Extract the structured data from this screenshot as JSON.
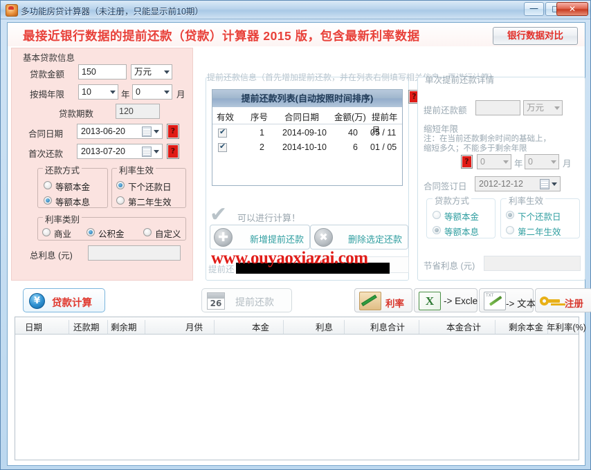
{
  "window": {
    "title": "多功能房贷计算器（未注册，只能显示前10期）",
    "minimize": "—",
    "maximize": "□",
    "close": "✕"
  },
  "banner": {
    "headline": "最接近银行数据的提前还款（贷款）计算器 2015 版，包含最新利率数据",
    "bank_compare_button": "银行数据对比"
  },
  "left_panel": {
    "group_title": "基本贷款信息",
    "loan_amount_label": "贷款金额",
    "loan_amount_value": "150",
    "loan_amount_unit": "万元",
    "mortgage_years_label": "按揭年限",
    "mortgage_years_value": "10",
    "years_unit": "年",
    "mortgage_months_value": "0",
    "months_unit": "月",
    "periods_label": "贷款期数",
    "periods_value": "120",
    "contract_date_label": "合同日期",
    "contract_date_value": "2013-06-20",
    "first_repay_label": "首次还款",
    "first_repay_value": "2013-07-20",
    "repay_method_group": "还款方式",
    "repay_method_options": [
      "等额本金",
      "等额本息"
    ],
    "repay_method_selected": "等额本息",
    "rate_effect_group": "利率生效",
    "rate_effect_options": [
      "下个还款日",
      "第二年生效"
    ],
    "rate_effect_selected": "下个还款日",
    "rate_type_group": "利率类别",
    "rate_type_options": [
      "商业",
      "公积金",
      "自定义"
    ],
    "rate_type_selected": "公积金",
    "total_interest_label": "总利息 (元)",
    "total_interest_value": "",
    "help_icon": "question-mark"
  },
  "mid_panel": {
    "note": "提前还款信息（首先增加提前还款，并在列表右侧填写相关信息，再进行计算）",
    "list_title": "提前还款列表(自动按照时间排序)",
    "columns": [
      "有效",
      "序号",
      "合同日期",
      "金额(万)",
      "提前年月"
    ],
    "rows": [
      {
        "checked": true,
        "index": "1",
        "date": "2014-09-10",
        "amount": "40",
        "advance": "05 / 11"
      },
      {
        "checked": true,
        "index": "2",
        "date": "2014-10-10",
        "amount": "6",
        "advance": "01 / 05"
      }
    ],
    "status_text": "可以进行计算！",
    "add_button": "新增提前还款",
    "delete_button": "删除选定还款",
    "prepay_field_label": "提前还",
    "prepay_field_value": "",
    "watermark": "www.ouyaoxiazai.com"
  },
  "right_panel": {
    "group_title": "单次提前还款详情",
    "prepay_amount_label": "提前还款额",
    "prepay_amount_value": "",
    "prepay_amount_unit": "万元",
    "shorten_label": "缩短年限",
    "shorten_note_line1": "注：在当前还款剩余时间的基础上，",
    "shorten_note_line2": "缩短多久；不能多于剩余年限",
    "shorten_years_value": "0",
    "years_unit": "年",
    "shorten_months_value": "0",
    "months_unit": "月",
    "sign_date_label": "合同签订日",
    "sign_date_value": "2012-12-12",
    "loan_method_group": "贷款方式",
    "loan_method_options": [
      "等额本金",
      "等额本息"
    ],
    "loan_method_selected": "等额本息",
    "rate_effect_group": "利率生效",
    "rate_effect_options": [
      "下个还款日",
      "第二年生效"
    ],
    "rate_effect_selected": "下个还款日",
    "saved_interest_label": "节省利息 (元)",
    "saved_interest_value": ""
  },
  "toolbar": {
    "calc_button": "贷款计算",
    "calc_icon": "yen-coin-icon",
    "prepay_button": "提前还款",
    "prepay_icon_day": "26",
    "rate_button": "利率",
    "excel_button": "-> Excle",
    "text_button": "-> 文本",
    "register_button": "注册"
  },
  "grid": {
    "columns": [
      "日期",
      "还款期",
      "剩余期",
      "月供",
      "本金",
      "利息",
      "利息合计",
      "本金合计",
      "剩余本金",
      "年利率(%)"
    ],
    "rows": []
  },
  "colors": {
    "accent_red": "#e8413a",
    "panel_pink": "#fbe3e0",
    "teal_text": "#2f9ea0",
    "title_blue": "#1b3a5c"
  }
}
